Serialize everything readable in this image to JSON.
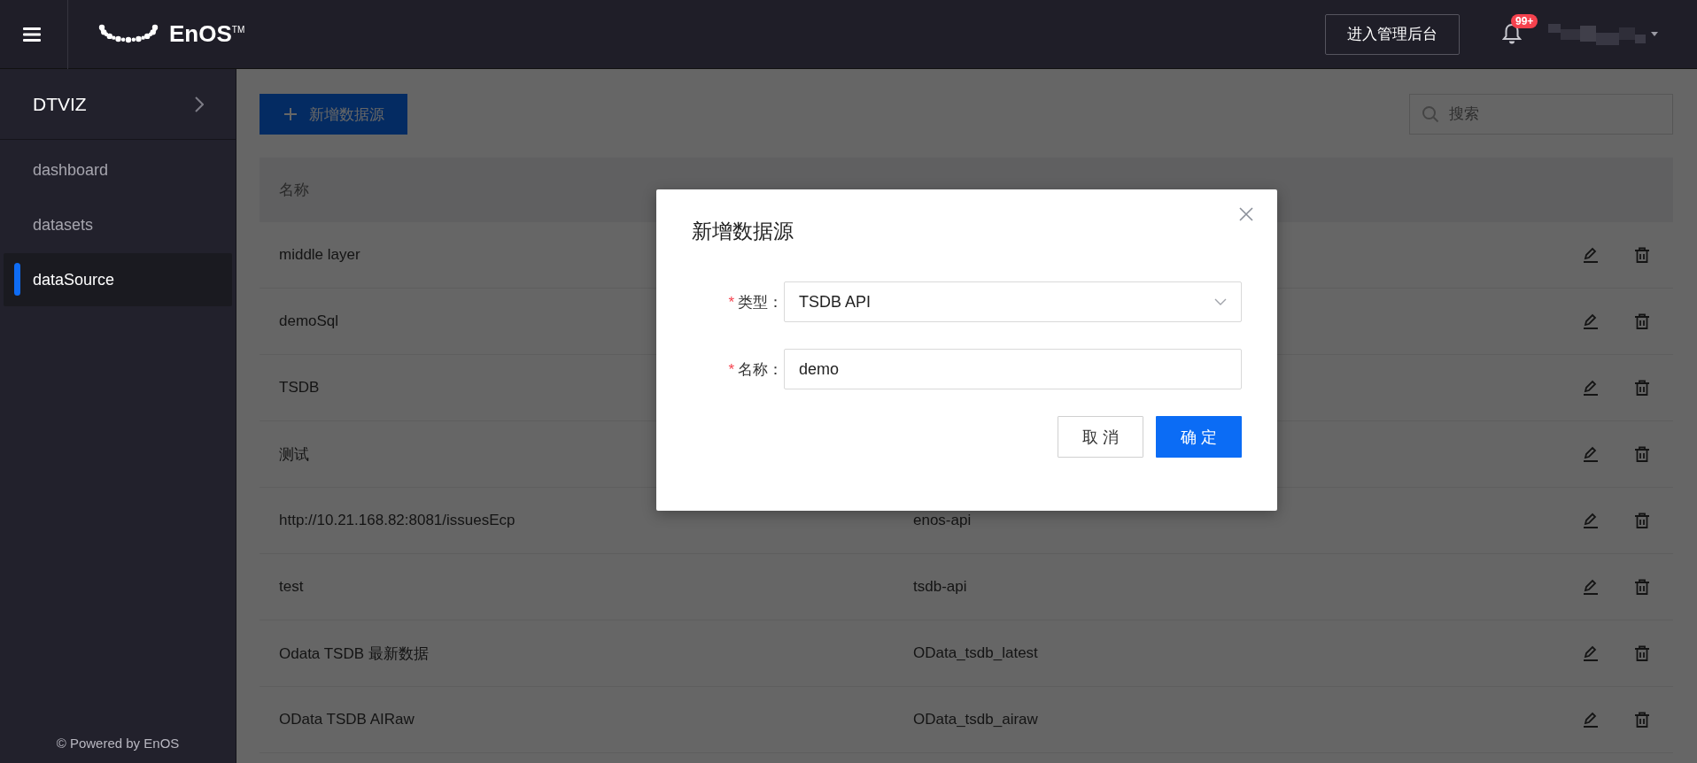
{
  "header": {
    "logo_text": "EnOS$^{TM}$",
    "admin_button": "进入管理后台",
    "notification_badge": "99+"
  },
  "sidebar": {
    "title": "DTVIZ",
    "items": [
      {
        "label": "dashboard",
        "selected": false
      },
      {
        "label": "datasets",
        "selected": false
      },
      {
        "label": "dataSource",
        "selected": true
      }
    ],
    "footer": "© Powered by EnOS"
  },
  "toolbar": {
    "add_button": "新增数据源",
    "search": {
      "placeholder": "搜索"
    }
  },
  "table": {
    "columns": [
      "名称"
    ],
    "rows": [
      {
        "name": "middle layer"
      },
      {
        "name": "demoSql"
      },
      {
        "name": "TSDB"
      },
      {
        "name": "测试"
      },
      {
        "name": "http://10.21.168.82:8081/issuesEcp",
        "type": "enos-api"
      },
      {
        "name": "test",
        "type": "tsdb-api"
      },
      {
        "name": "Odata TSDB 最新数据",
        "type": "OData_tsdb_latest"
      },
      {
        "name": "OData TSDB AIRaw",
        "type": "OData_tsdb_airaw"
      }
    ]
  },
  "dialog": {
    "title": "新增数据源",
    "required_mark": "*",
    "fields": [
      {
        "label": "类型：",
        "required": true,
        "kind": "select",
        "value": "TSDB API"
      },
      {
        "label": "名称：",
        "required": true,
        "kind": "text",
        "value": "demo"
      }
    ],
    "buttons": [
      {
        "label": "取 消",
        "kind": "secondary"
      },
      {
        "label": "确 定",
        "kind": "primary"
      }
    ]
  }
}
